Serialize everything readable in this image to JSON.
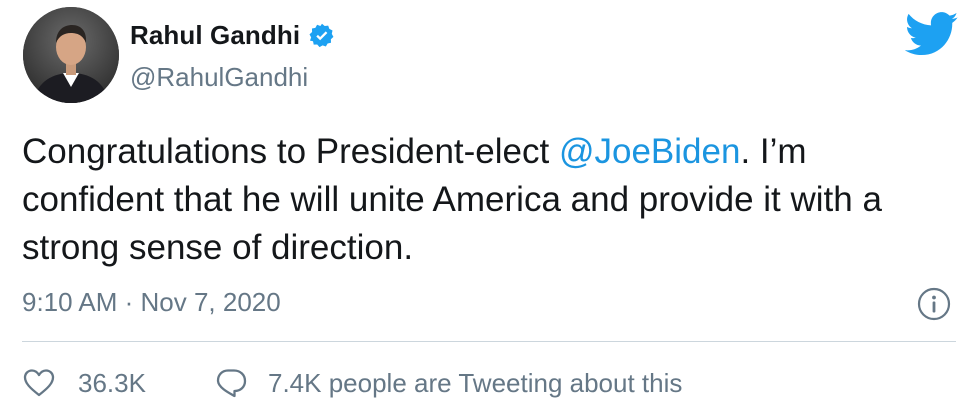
{
  "author": {
    "display_name": "Rahul Gandhi",
    "handle": "@RahulGandhi",
    "verified_icon": "verified-badge-icon",
    "avatar": "profile-photo"
  },
  "tweet": {
    "text_before": "Congratulations to President-elect ",
    "mention": "@JoeBiden",
    "text_after": ". I’m confident that he will unite America and provide it with a strong sense of direction.",
    "timestamp": "9:10 AM · Nov 7, 2020"
  },
  "engagement": {
    "likes": "36.3K",
    "conversation": "7.4K people are Tweeting about this"
  },
  "icons": {
    "brand": "twitter-bird-icon",
    "info": "info-icon",
    "like": "heart-icon",
    "conversation": "speech-bubble-icon"
  },
  "colors": {
    "brand_blue": "#1da1f2",
    "mention_blue": "#1b95e0",
    "secondary_text": "#657786",
    "divider": "#ccd6dd"
  }
}
